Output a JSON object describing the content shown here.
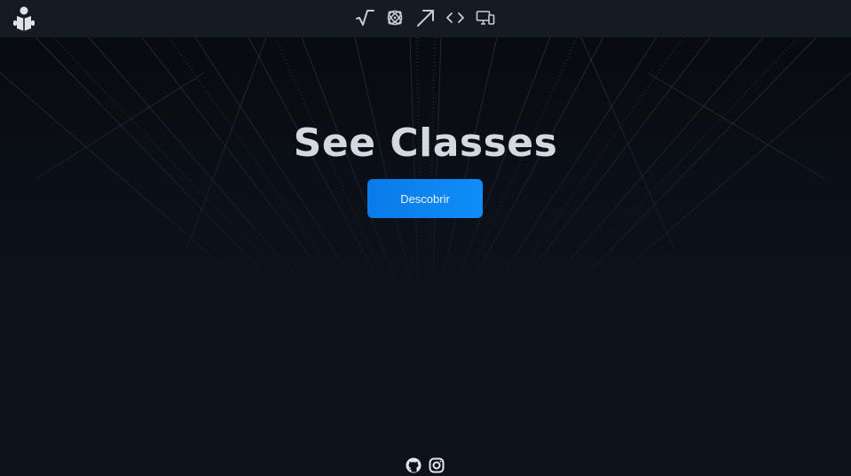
{
  "header": {
    "logo_icon": "reader-person-icon",
    "nav": [
      {
        "icon": "square-root-icon"
      },
      {
        "icon": "atom-icon"
      },
      {
        "icon": "arrow-up-right-icon"
      },
      {
        "icon": "code-brackets-icon"
      },
      {
        "icon": "devices-icon"
      }
    ]
  },
  "hero": {
    "title": "See Classes",
    "cta_label": "Descobrir"
  },
  "footer": {
    "social": [
      {
        "icon": "github-icon"
      },
      {
        "icon": "instagram-icon"
      }
    ]
  },
  "colors": {
    "accent": "#0a84f5",
    "header_bg": "#151b23",
    "page_bg": "#0c1118",
    "title_text": "#d4d9df",
    "icon": "#c6ccd3"
  }
}
